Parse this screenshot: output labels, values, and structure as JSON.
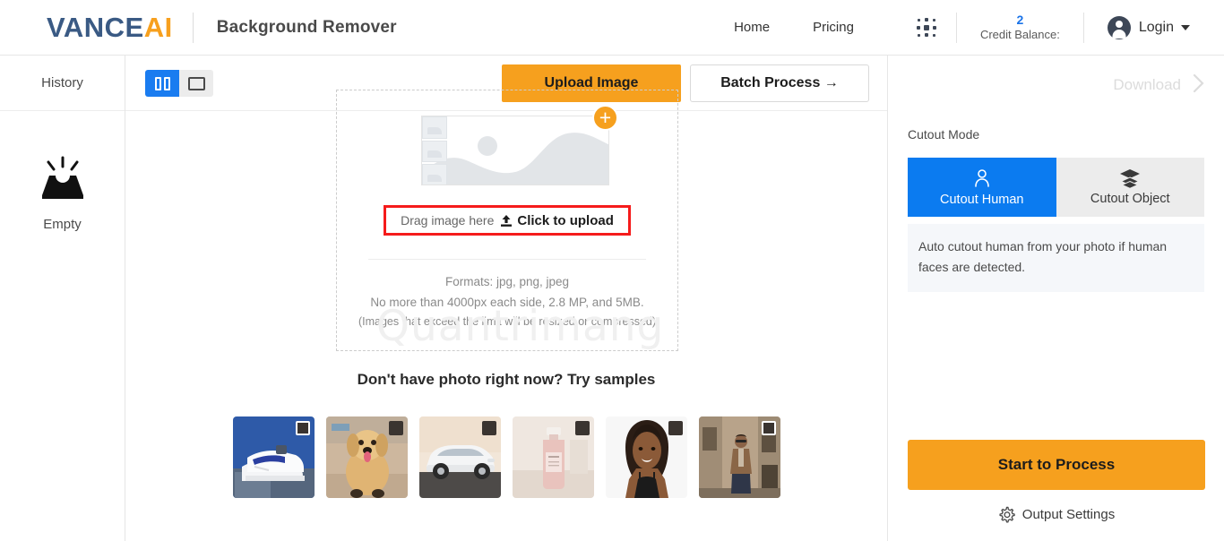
{
  "header": {
    "logo_primary": "VANCE",
    "logo_accent": "AI",
    "app_title": "Background Remover",
    "nav": [
      {
        "label": "Home",
        "name": "nav-home"
      },
      {
        "label": "Pricing",
        "name": "nav-pricing"
      }
    ],
    "apps_grid_icon": "grid-dots-icon",
    "credit": {
      "value": "2",
      "label": "Credit Balance:"
    },
    "login": {
      "label": "Login",
      "avatar_icon": "user-avatar-icon",
      "caret_icon": "chevron-down-icon"
    }
  },
  "sidebar": {
    "title": "History",
    "empty_icon": "inbox-tray-icon",
    "empty_label": "Empty"
  },
  "toolbar": {
    "view_split_label": "split-view",
    "view_single_label": "single-view",
    "upload_label": "Upload Image",
    "batch_label": "Batch Process  →"
  },
  "dropzone": {
    "placeholder_icon": "image-placeholder-icon",
    "add_badge": "+",
    "drag_text": "Drag image here",
    "upload_icon": "upload-arrow-icon",
    "click_text": "Click to upload",
    "formats": "Formats: jpg, png, jpeg",
    "limits": "No more than 4000px each side, 2.8 MP, and 5MB.",
    "note": "(Images that exceed the limit will be resized or compressed)"
  },
  "samples": {
    "title": "Don't have photo right now? Try samples",
    "items": [
      {
        "name": "sample-sneakers",
        "alt": "white sneakers on blue",
        "selected": true
      },
      {
        "name": "sample-dog",
        "alt": "golden retriever puppy",
        "selected": false
      },
      {
        "name": "sample-car",
        "alt": "white car",
        "selected": false
      },
      {
        "name": "sample-bottle",
        "alt": "cosmetic bottle",
        "selected": false
      },
      {
        "name": "sample-woman",
        "alt": "smiling woman portrait",
        "selected": false
      },
      {
        "name": "sample-man",
        "alt": "man in brown shirt",
        "selected": true
      }
    ]
  },
  "right_panel": {
    "download_label": "Download",
    "download_chevron": "chevron-right-icon",
    "cutout_mode_label": "Cutout Mode",
    "modes": [
      {
        "label": "Cutout Human",
        "icon": "person-icon",
        "active": true
      },
      {
        "label": "Cutout Object",
        "icon": "layers-icon",
        "active": false
      }
    ],
    "mode_description": "Auto cutout human from your photo if human faces are detected.",
    "process_label": "Start to Process",
    "output_settings_label": "Output Settings",
    "output_settings_icon": "gear-icon"
  },
  "watermark": {
    "text": "Quantrimang"
  },
  "colors": {
    "brand_blue": "#3a5a84",
    "brand_orange": "#f6a01e",
    "accent_blue": "#0b7bf0",
    "alert_red": "#f51b1b",
    "credit_blue": "#1a73e8"
  }
}
